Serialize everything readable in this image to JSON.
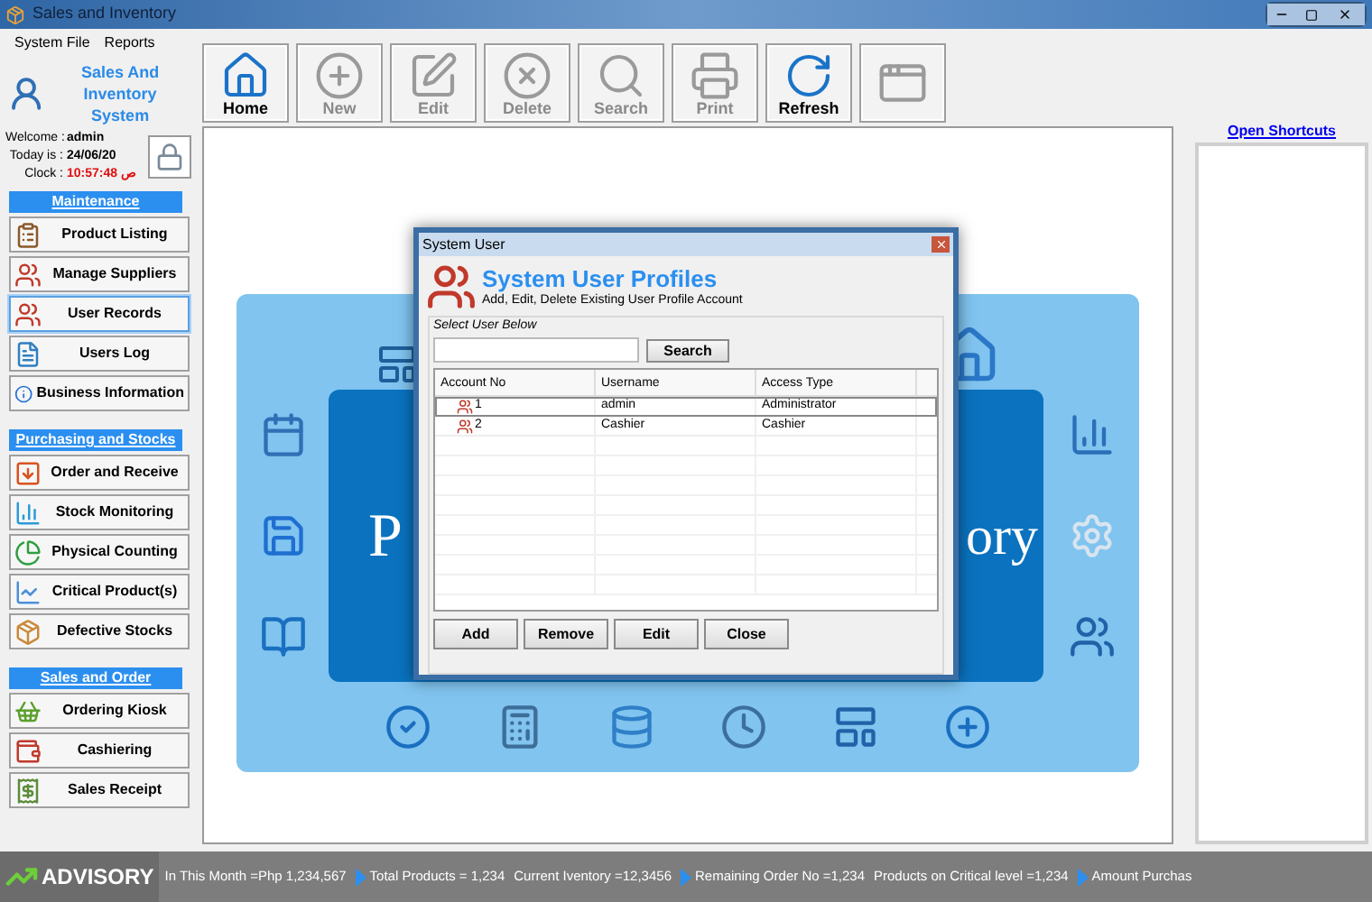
{
  "window": {
    "title": "Sales and Inventory"
  },
  "menu": [
    "System File",
    "Reports"
  ],
  "app_name": "Sales And Inventory System",
  "session": [
    {
      "label": "Welcome :",
      "value": "admin",
      "kind": "plain"
    },
    {
      "label": "Today is :",
      "value": "24/06/20",
      "kind": "plain"
    },
    {
      "label": "Clock :",
      "value": "10:57:48 ص",
      "kind": "alert"
    }
  ],
  "toolbar": [
    {
      "label": "Home",
      "disabled": false
    },
    {
      "label": "New",
      "disabled": true
    },
    {
      "label": "Edit",
      "disabled": true
    },
    {
      "label": "Delete",
      "disabled": true
    },
    {
      "label": "Search",
      "disabled": true
    },
    {
      "label": "Print",
      "disabled": true
    },
    {
      "label": "Refresh",
      "disabled": false
    },
    {
      "disabled": true
    }
  ],
  "sidebar": [
    {
      "title": "Maintenance",
      "items": [
        {
          "label": "Product Listing",
          "selected": false
        },
        {
          "label": "Manage Suppliers",
          "selected": false
        },
        {
          "label": "User Records",
          "selected": true
        },
        {
          "label": "Users Log",
          "selected": false
        },
        {
          "label": "Business Information",
          "selected": false
        }
      ]
    },
    {
      "title": "Purchasing and Stocks",
      "items": [
        {
          "label": "Order and Receive",
          "selected": false
        },
        {
          "label": "Stock Monitoring",
          "selected": false
        },
        {
          "label": "Physical Counting",
          "selected": false
        },
        {
          "label": "Critical Product(s)",
          "selected": false
        },
        {
          "label": "Defective Stocks",
          "selected": false
        }
      ]
    },
    {
      "title": "Sales and Order",
      "items": [
        {
          "label": "Ordering Kiosk",
          "selected": false
        },
        {
          "label": "Cashiering",
          "selected": false
        },
        {
          "label": "Sales Receipt",
          "selected": false
        }
      ]
    }
  ],
  "banner": {
    "text_left": "P",
    "text_right": "ory"
  },
  "dialog": {
    "title": "System User",
    "heading": "System User Profiles",
    "subtitle": "Add, Edit, Delete Existing User Profile Account",
    "group_label": "Select User Below",
    "search_button": "Search",
    "table": {
      "columns": [
        "Account No",
        "Username",
        "Access Type"
      ],
      "rows": [
        {
          "cells": [
            "1",
            "admin",
            "Administrator"
          ],
          "selected": true
        },
        {
          "cells": [
            "2",
            "Cashier",
            "Cashier"
          ],
          "selected": false
        }
      ]
    },
    "buttons": [
      "Add",
      "Remove",
      "Edit",
      "Close"
    ]
  },
  "shortcuts_link": "Open Shortcuts",
  "advisory": {
    "label": "ADVISORY",
    "items": [
      {
        "text": "In This Month =Php 1,234,567",
        "arrow": false
      },
      {
        "text": "Total Products = 1,234",
        "arrow": true
      },
      {
        "text": "Current Iventory =12,3456",
        "arrow": false
      },
      {
        "text": "Remaining Order No =1,234",
        "arrow": true
      },
      {
        "text": "Products on Critical level =1,234",
        "arrow": false
      },
      {
        "text": "Amount Purchas",
        "arrow": true
      }
    ]
  }
}
